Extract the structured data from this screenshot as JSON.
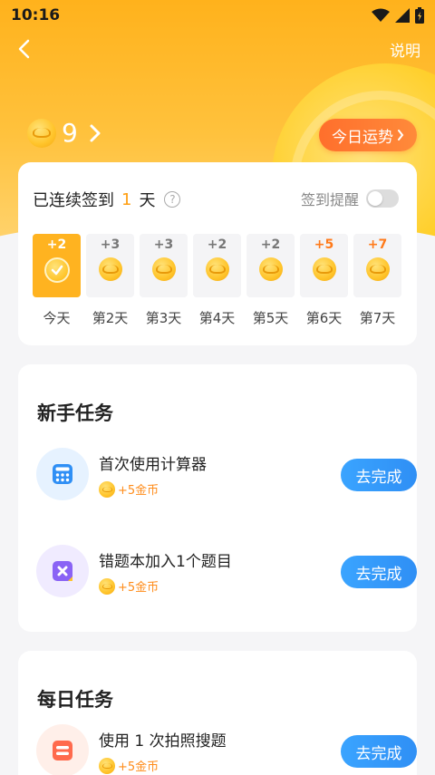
{
  "status_bar": {
    "time": "10:16"
  },
  "topbar": {
    "explain_label": "说明"
  },
  "coins": {
    "count": "9"
  },
  "fortune_button": {
    "label": "今日运势"
  },
  "signin": {
    "title_prefix": "已连续签到",
    "days": "1",
    "title_suffix": "天",
    "remind_label": "签到提醒",
    "remind_on": false,
    "days_list": [
      {
        "amount": "+2",
        "label": "今天",
        "today": true,
        "hot": false
      },
      {
        "amount": "+3",
        "label": "第2天",
        "today": false,
        "hot": false
      },
      {
        "amount": "+3",
        "label": "第3天",
        "today": false,
        "hot": false
      },
      {
        "amount": "+2",
        "label": "第4天",
        "today": false,
        "hot": false
      },
      {
        "amount": "+2",
        "label": "第5天",
        "today": false,
        "hot": false
      },
      {
        "amount": "+5",
        "label": "第6天",
        "today": false,
        "hot": true
      },
      {
        "amount": "+7",
        "label": "第7天",
        "today": false,
        "hot": true
      }
    ]
  },
  "newbie": {
    "title": "新手任务",
    "tasks": [
      {
        "title": "首次使用计算器",
        "reward": "+5金币",
        "button": "去完成",
        "icon": "calculator-icon",
        "icon_color": "#2f8ff5",
        "icon_bg": "#e6f2ff"
      },
      {
        "title": "错题本加入1个题目",
        "reward": "+5金币",
        "button": "去完成",
        "icon": "wrong-book-icon",
        "icon_color": "#8a63f5",
        "icon_bg": "#f0ebff"
      }
    ]
  },
  "daily": {
    "title": "每日任务",
    "tasks": [
      {
        "title": "使用 1 次拍照搜题",
        "reward": "+5金币",
        "button": "去完成",
        "icon": "photo-search-icon",
        "icon_color": "#ff6a4d",
        "icon_bg": "#ffefe9"
      }
    ]
  },
  "colors": {
    "accent": "#ffb320",
    "button_blue": "#2f8ff5",
    "fortune_orange": "#ff7a2c"
  }
}
